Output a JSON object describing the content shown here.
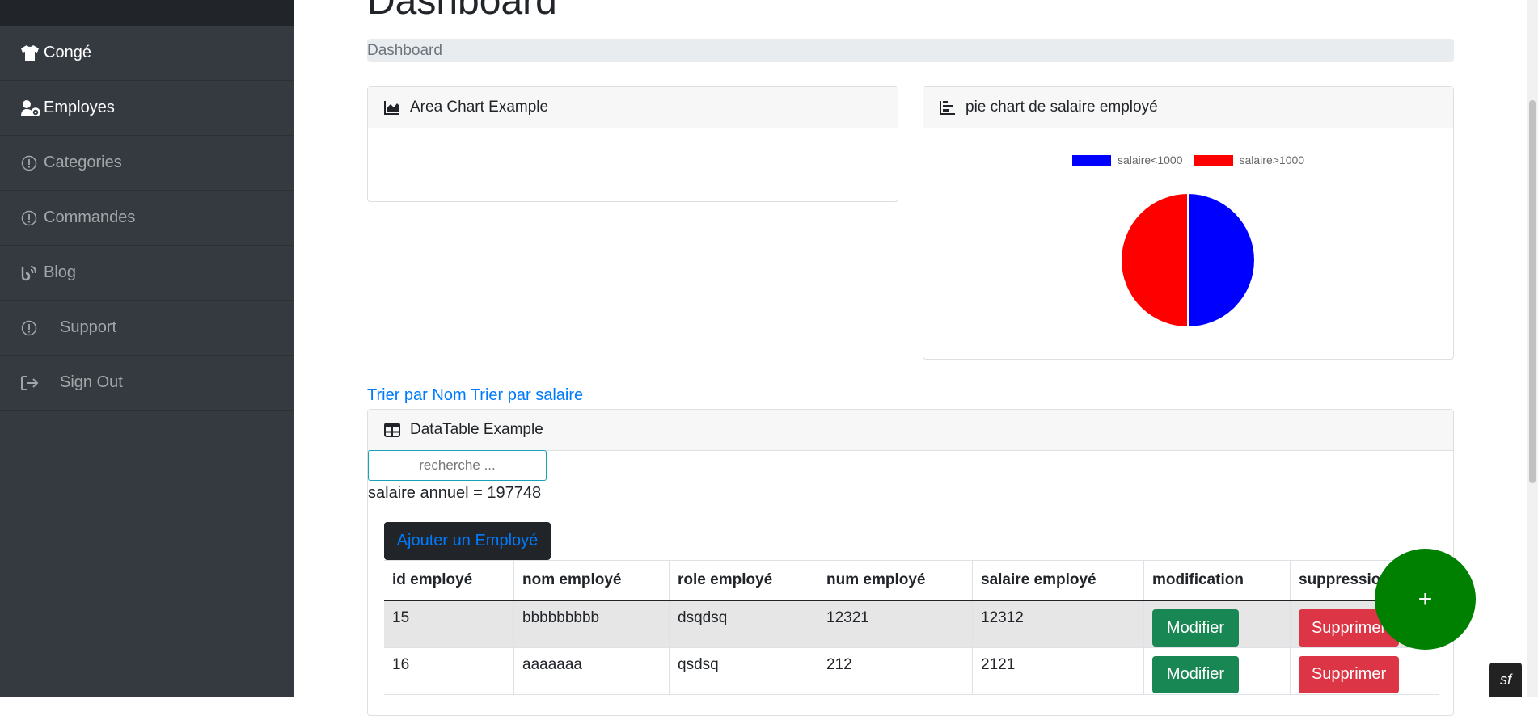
{
  "sidebar": {
    "items": [
      {
        "label": "Congé",
        "icon": "shirt-icon"
      },
      {
        "label": "Employes",
        "icon": "user-cog-icon"
      },
      {
        "label": "Categories",
        "icon": "exclamation-circle-icon"
      },
      {
        "label": "Commandes",
        "icon": "exclamation-circle-icon"
      },
      {
        "label": "Blog",
        "icon": "blog-icon"
      },
      {
        "label": "Support",
        "icon": "exclamation-circle-icon"
      },
      {
        "label": "Sign Out",
        "icon": "sign-out-icon"
      }
    ]
  },
  "page": {
    "title": "Dashboard",
    "breadcrumb": "Dashboard"
  },
  "area_card": {
    "title": "Area Chart Example"
  },
  "pie_card": {
    "title": "pie chart de salaire employé"
  },
  "chart_data": {
    "type": "pie",
    "categories": [
      "salaire<1000",
      "salaire>1000"
    ],
    "values": [
      50,
      50
    ],
    "colors": [
      "#0000ff",
      "#ff0000"
    ],
    "legend": "top"
  },
  "sort": {
    "by_name": "Trier par Nom",
    "by_salary": "Trier par salaire"
  },
  "table_card": {
    "title": "DataTable Example",
    "search_placeholder": "recherche ...",
    "salary_annual": "salaire annuel = 197748",
    "add_button": "Ajouter un Employé",
    "headers": [
      "id employé",
      "nom employé",
      "role employé",
      "num employé",
      "salaire employé",
      "modification",
      "suppression"
    ],
    "rows": [
      {
        "id": "15",
        "nom": "bbbbbbbbb",
        "role": "dsqdsq",
        "num": "12321",
        "salaire": "12312"
      },
      {
        "id": "16",
        "nom": "aaaaaaa",
        "role": "qsdsq",
        "num": "212",
        "salaire": "2121"
      }
    ],
    "modify_label": "Modifier",
    "delete_label": "Supprimer"
  },
  "fab": {
    "label": "+"
  },
  "symfony_badge": "sf",
  "colors": {
    "sidebar_bg": "#343a40",
    "link": "#007bff",
    "success": "#198754",
    "danger": "#dc3545",
    "fab": "#008000"
  }
}
